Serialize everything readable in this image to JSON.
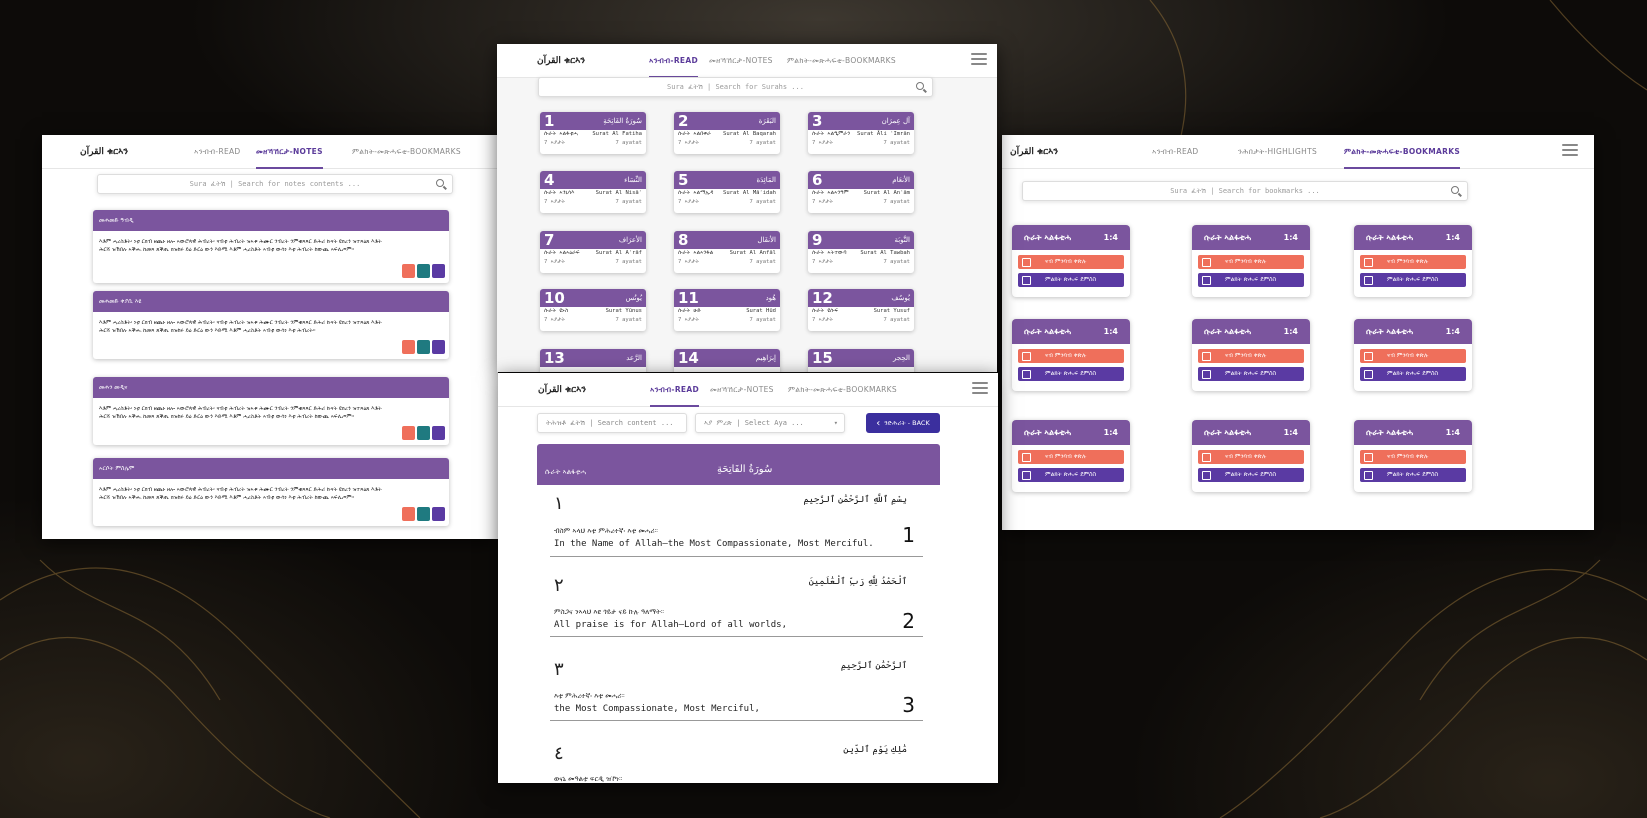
{
  "colors": {
    "purple": "#7b559e",
    "deep_purple": "#5a3aa3",
    "coral": "#ef6f5b",
    "teal": "#1f7a80"
  },
  "logo": "القرآن ቁርኣን",
  "notes_window": {
    "tabs": [
      "ኣንብብ-READ",
      "መዘኻኸርታ-NOTES",
      "ምልክት-መጽሓፍቲ-BOOKMARKS"
    ],
    "search_placeholder": "Sura ፈትሽ | Search for notes contents ...",
    "notes": [
      {
        "title": "መሐመድ ዓብዲ",
        "body": "እቶም ሓረስቶት፡ ነቲ ርክብ ዘጨኑ ዘሎ ኣውሮጳዊ ሕብረት፡ ናብቲ ሕብረት ዝኣቱ ሕሙር ንብረት ንምቁጻጻር ድሕሪ ኩናት ዩክረን ዝተጻዕጸ እቶት ሕርሻ ዝኽበሉ ኣቕሑ ከመጻ ጸቕጢ ክዝከሩ ይዕ ድርዕ ውን እድሚ እቶም ሓረስቶት ኣብቲ ውሳነ እቲ ሕብረት ከውጪ ኣፍሊጦም።"
      },
      {
        "title": "መሐመድ ቀያሲ እዩ",
        "body": "እቶም ሓረስቶት፡ ነቲ ርክብ ዘጨኑ ዘሎ ኣውሮጳዊ ሕብረት፡ ናብቲ ሕብረት ዝኣቱ ሕሙር ንብረት ንምቁጻጻር ድሕሪ ኩናት ዩክረን ዝተጻዕጸ እቶት ሕርሻ ዝኽበሉ ኣቕሑ ከመጻ ጸቕጢ ክዝከሩ ይዕ ድርዕ ውን እድሚ እቶም ሓረስቶት ኣብቲ ውሳነ እቲ ሕብረት።"
      },
      {
        "title": "መሐን መዲና",
        "body": "እቶም ሓረስቶት፡ ነቲ ርክብ ዘጨኑ ዘሎ ኣውሮጳዊ ሕብረት፡ ናብቲ ሕብረት ዝኣቱ ሕሙር ንብረት ንምቁጻጻር ድሕሪ ኩናት ዩክረን ዝተጻዕጸ እቶት ሕርሻ ዝኽበሉ ኣቕሑ ከመጻ ጸቕጢ ክዝከሩ ይዕ ድርዕ ውን እድሚ እቶም ሓረስቶት ኣብቲ ውሳነ እቲ ሕብረት ከውጪ ኣፍሊጦም።"
      },
      {
        "title": "ኣርሶት ምስሌሞ",
        "body": "እቶም ሓረስቶት፡ ነቲ ርክብ ዘጨኑ ዘሎ ኣውሮጳዊ ሕብረት፡ ናብቲ ሕብረት ዝኣቱ ሕሙር ንብረት ንምቁጻጻር ድሕሪ ኩናት ዩክረን ዝተጻዕጸ እቶት ሕርሻ ዝኽበሉ ኣቕሑ ከመጻ ጸቕጢ ክዝከሩ ይዕ ድርዕ ውን እድሚ እቶም ሓረስቶት ኣብቲ ውሳነ እቲ ሕብረት ከውጪ ኣፍሊጦም።"
      }
    ]
  },
  "surah_window": {
    "tabs": [
      "ኣንብብ-READ",
      "መዘኻኸርታ-NOTES",
      "ምልክት-መጽሓፍቲ-BOOKMARKS"
    ],
    "search_placeholder": "Sura ፈትሽ | Search for Surahs ...",
    "surahs": [
      {
        "num": "1",
        "ar": "سُورَةُ الفَاتِحَةِ",
        "ti": "ሱራት ኣልፋቲሓ",
        "en": "Surat Al Fatiha",
        "sub": "7 ኣያታት",
        "ay": "7 ayatat"
      },
      {
        "num": "2",
        "ar": "البَقَرَة",
        "ti": "ሱራት ኣልበቀራ",
        "en": "Surat Al Baqarah",
        "sub": "7 ኣያታት",
        "ay": "7 ayatat"
      },
      {
        "num": "3",
        "ar": "آل عِمرَان",
        "ti": "ሱራት ኣልዒምራን",
        "en": "Surat Āli ʿImrān",
        "sub": "7 ኣያታት",
        "ay": "7 ayatat"
      },
      {
        "num": "4",
        "ar": "النِّسَاء",
        "ti": "ሱራት ኣንኒሳእ",
        "en": "Surat Al Nisāʾ",
        "sub": "7 ኣያታት",
        "ay": "7 ayatat"
      },
      {
        "num": "5",
        "ar": "المَائِدَة",
        "ti": "ሱራት ኣልማኢዳ",
        "en": "Surat Al Māʾidah",
        "sub": "7 ኣያታት",
        "ay": "7 ayatat"
      },
      {
        "num": "6",
        "ar": "الأنعَام",
        "ti": "ሱራት ኣልኣንዓም",
        "en": "Surat Al Anʿām",
        "sub": "7 ኣያታት",
        "ay": "7 ayatat"
      },
      {
        "num": "7",
        "ar": "الأعرَاف",
        "ti": "ሱራት ኣልኣዕራፍ",
        "en": "Surat Al Aʿrāf",
        "sub": "7 ኣያታት",
        "ay": "7 ayatat"
      },
      {
        "num": "8",
        "ar": "الأنفَال",
        "ti": "ሱራት ኣልኣንፋል",
        "en": "Surat Al Anfāl",
        "sub": "7 ኣያታት",
        "ay": "7 ayatat"
      },
      {
        "num": "9",
        "ar": "التَّوبَة",
        "ti": "ሱራት ኣትተውባ",
        "en": "Surat Al Tawbah",
        "sub": "7 ኣያታት",
        "ay": "7 ayatat"
      },
      {
        "num": "10",
        "ar": "يُونُس",
        "ti": "ሱራት ዩኑስ",
        "en": "Surat Yūnus",
        "sub": "7 ኣያታት",
        "ay": "7 ayatat"
      },
      {
        "num": "11",
        "ar": "هُود",
        "ti": "ሱራት ሁድ",
        "en": "Surat Hūd",
        "sub": "7 ኣያታት",
        "ay": "7 ayatat"
      },
      {
        "num": "12",
        "ar": "يُوسُف",
        "ti": "ሱራት ዩሱፍ",
        "en": "Surat Yusuf",
        "sub": "7 ኣያታት",
        "ay": "7 ayatat"
      },
      {
        "num": "13",
        "ar": "الرَّعد",
        "ti": "",
        "en": "",
        "sub": "",
        "ay": ""
      },
      {
        "num": "14",
        "ar": "إبرَاهِيم",
        "ti": "",
        "en": "",
        "sub": "",
        "ay": ""
      },
      {
        "num": "15",
        "ar": "الحِجر",
        "ti": "",
        "en": "",
        "sub": "",
        "ay": ""
      }
    ]
  },
  "bookmarks_window": {
    "tabs": [
      "ኣንብብ-READ",
      "ንሕበታት-HIGHLIGHTS",
      "ምልክት-መጽሓፍቲ-BOOKMARKS"
    ],
    "search_placeholder": "Sura ፈትሽ | Search for bookmarks  ...",
    "card_title": "ሱራት ኣልፋቲሓ",
    "card_ref": "1:4",
    "remove_label": "ናብ ምንባብ ቀጽሉ",
    "open_label": "ምልክት ጽሑፍ ደምስስ"
  },
  "reader_window": {
    "tabs": [
      "ኣንብብ-READ",
      "መዘኻኸርታ-NOTES",
      "ምልክት-መጽሓፍቲ-BOOKMARKS"
    ],
    "content_search": "ትሕዝቶ ፈትሽ | Search content ...",
    "aya_select": "ኣያ ምረጽ | Select Aya ...",
    "back_label": "ንድሕሪት - BACK",
    "surah_ti": "ሱራት ኣልፋቲሓ",
    "surah_ar": "سُورَةُ الفَاتِحَةِ",
    "verses": [
      {
        "ar_num": "١",
        "ar": "بِسْمِ ٱللَّهِ ٱلرَّحْمَٰنِ ٱلرَّحِيمِ",
        "am": "ብስም ኣላህ እቲ ምሕረተኛ፡ እቲ መሓሪ።",
        "en": "In the Name of Allah—the Most Compassionate, Most Merciful.",
        "num": "1"
      },
      {
        "ar_num": "٢",
        "ar": "ٱلْحَمْدُ لِلَّهِ رَبِّ ٱلْعَٰلَمِينَ",
        "am": "ምስጋና ንኣላህ እዩ ጎይታ ናይ ኩሉ ዓለማት።",
        "en": "All praise is for Allah—Lord of all worlds,",
        "num": "2"
      },
      {
        "ar_num": "٣",
        "ar": "ٱلرَّحْمَٰنِ ٱلرَّحِيمِ",
        "am": "እቲ ምሕረተኛ፡ እቲ መሓሪ።",
        "en": "the Most Compassionate, Most Merciful,",
        "num": "3"
      },
      {
        "ar_num": "٤",
        "ar": "مَٰلِكِ يَوْمِ ٱلدِّينِ",
        "am": "ወናኒ መዓልቲ ፍርዲ ዝኾነ።",
        "en": "",
        "num": ""
      }
    ]
  }
}
